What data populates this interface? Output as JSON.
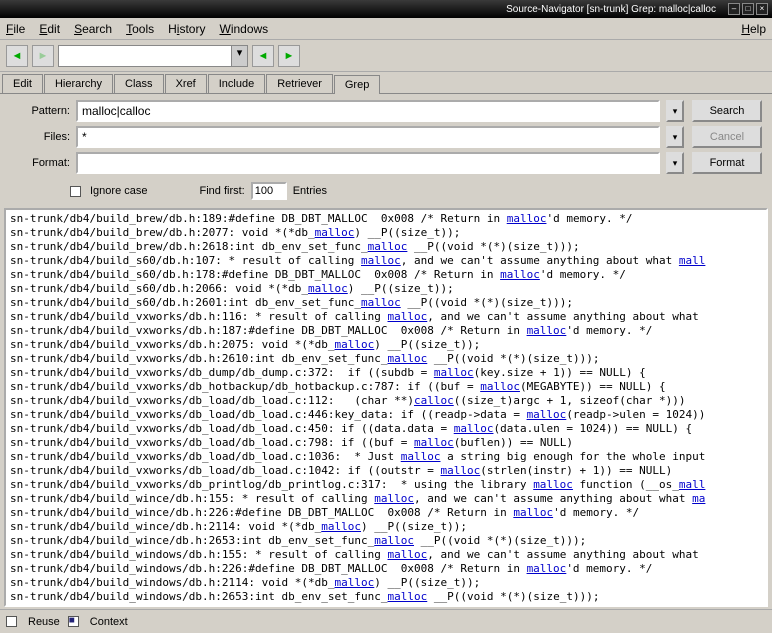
{
  "window": {
    "title": "Source-Navigator [sn-trunk] Grep: malloc|calloc"
  },
  "menubar": [
    "File",
    "Edit",
    "Search",
    "Tools",
    "History",
    "Windows",
    "Help"
  ],
  "tabs": [
    "Edit",
    "Hierarchy",
    "Class",
    "Xref",
    "Include",
    "Retriever",
    "Grep"
  ],
  "form": {
    "pattern_label": "Pattern:",
    "pattern_value": "malloc|calloc",
    "files_label": "Files:",
    "files_value": "*",
    "format_label": "Format:",
    "format_value": ""
  },
  "buttons": {
    "search": "Search",
    "cancel": "Cancel",
    "format": "Format"
  },
  "options": {
    "ignore_case": "Ignore case",
    "find_first": "Find first:",
    "find_first_value": "100",
    "entries": "Entries"
  },
  "results_raw": "sn-trunk/db4/build_brew/db.h:189:#define DB_DBT_MALLOC  0x008 /* Return in <<malloc>>'d memory. */\nsn-trunk/db4/build_brew/db.h:2077: void *(*db_<<malloc>>) __P((size_t));\nsn-trunk/db4/build_brew/db.h:2618:int db_env_set_func_<<malloc>> __P((void *(*)(size_t)));\nsn-trunk/db4/build_s60/db.h:107: * result of calling <<malloc>>, and we can't assume anything about what <<mall>>\nsn-trunk/db4/build_s60/db.h:178:#define DB_DBT_MALLOC  0x008 /* Return in <<malloc>>'d memory. */\nsn-trunk/db4/build_s60/db.h:2066: void *(*db_<<malloc>>) __P((size_t));\nsn-trunk/db4/build_s60/db.h:2601:int db_env_set_func_<<malloc>> __P((void *(*)(size_t)));\nsn-trunk/db4/build_vxworks/db.h:116: * result of calling <<malloc>>, and we can't assume anything about what \nsn-trunk/db4/build_vxworks/db.h:187:#define DB_DBT_MALLOC  0x008 /* Return in <<malloc>>'d memory. */\nsn-trunk/db4/build_vxworks/db.h:2075: void *(*db_<<malloc>>) __P((size_t));\nsn-trunk/db4/build_vxworks/db.h:2610:int db_env_set_func_<<malloc>> __P((void *(*)(size_t)));\nsn-trunk/db4/build_vxworks/db_dump/db_dump.c:372:  if ((subdb = <<malloc>>(key.size + 1)) == NULL) {\nsn-trunk/db4/build_vxworks/db_hotbackup/db_hotbackup.c:787: if ((buf = <<malloc>>(MEGABYTE)) == NULL) {\nsn-trunk/db4/build_vxworks/db_load/db_load.c:112:   (char **)<<calloc>>((size_t)argc + 1, sizeof(char *)))\nsn-trunk/db4/build_vxworks/db_load/db_load.c:446:key_data: if ((readp->data = <<malloc>>(readp->ulen = 1024))\nsn-trunk/db4/build_vxworks/db_load/db_load.c:450: if ((data.data = <<malloc>>(data.ulen = 1024)) == NULL) {\nsn-trunk/db4/build_vxworks/db_load/db_load.c:798: if ((buf = <<malloc>>(buflen)) == NULL)\nsn-trunk/db4/build_vxworks/db_load/db_load.c:1036:  * Just <<malloc>> a string big enough for the whole input\nsn-trunk/db4/build_vxworks/db_load/db_load.c:1042: if ((outstr = <<malloc>>(strlen(instr) + 1)) == NULL)\nsn-trunk/db4/build_vxworks/db_printlog/db_printlog.c:317:  * using the library <<malloc>> function (__os_<<mall>>\nsn-trunk/db4/build_wince/db.h:155: * result of calling <<malloc>>, and we can't assume anything about what <<ma>>\nsn-trunk/db4/build_wince/db.h:226:#define DB_DBT_MALLOC  0x008 /* Return in <<malloc>>'d memory. */\nsn-trunk/db4/build_wince/db.h:2114: void *(*db_<<malloc>>) __P((size_t));\nsn-trunk/db4/build_wince/db.h:2653:int db_env_set_func_<<malloc>> __P((void *(*)(size_t)));\nsn-trunk/db4/build_windows/db.h:155: * result of calling <<malloc>>, and we can't assume anything about what \nsn-trunk/db4/build_windows/db.h:226:#define DB_DBT_MALLOC  0x008 /* Return in <<malloc>>'d memory. */\nsn-trunk/db4/build_windows/db.h:2114: void *(*db_<<malloc>>) __P((size_t));\nsn-trunk/db4/build_windows/db.h:2653:int db_env_set_func_<<malloc>> __P((void *(*)(size_t)));",
  "bottom": {
    "reuse": "Reuse",
    "context": "Context"
  }
}
